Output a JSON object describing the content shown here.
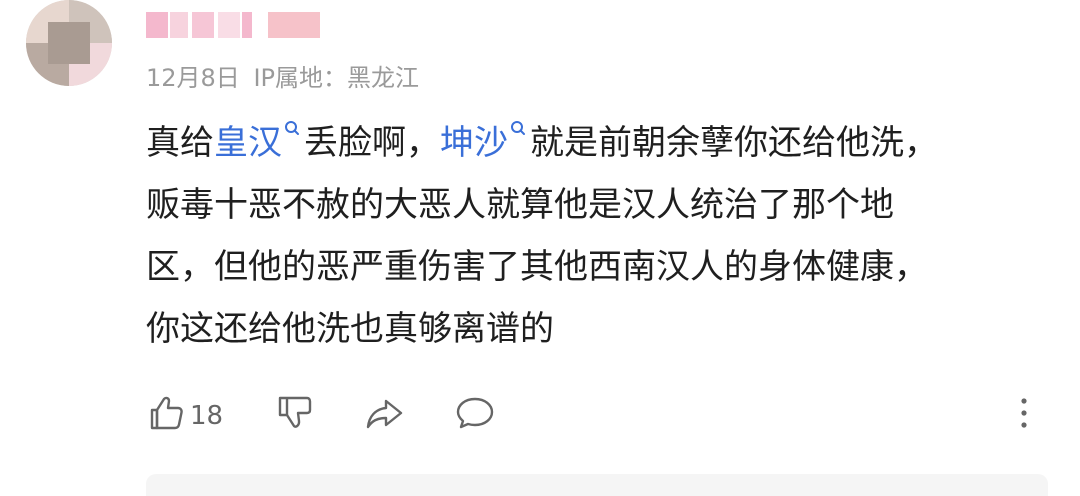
{
  "comment": {
    "meta": {
      "date": "12月8日",
      "ip_label": "IP属地：黑龙江"
    },
    "content": {
      "line1": {
        "t1": "真给",
        "link1": "皇汉",
        "t2": "丢脸啊，",
        "link2": "坤沙",
        "t3": "就是前朝余孽你还给他洗，"
      },
      "line2": "贩毒十恶不赦的大恶人就算他是汉人统治了那个地",
      "line3": "区，但他的恶严重伤害了其他西南汉人的身体健康，",
      "line4": "你这还给他洗也真够离谱的"
    },
    "actions": {
      "like_count": "18"
    }
  },
  "icons": {
    "like": "thumbs-up-icon",
    "dislike": "thumbs-down-icon",
    "share": "share-icon",
    "reply": "comment-icon",
    "more": "more-vertical-icon",
    "search": "search-icon"
  },
  "colors": {
    "text": "#1f1f1f",
    "meta": "#9a9a9a",
    "link": "#3a6fd8",
    "icon": "#666666"
  }
}
